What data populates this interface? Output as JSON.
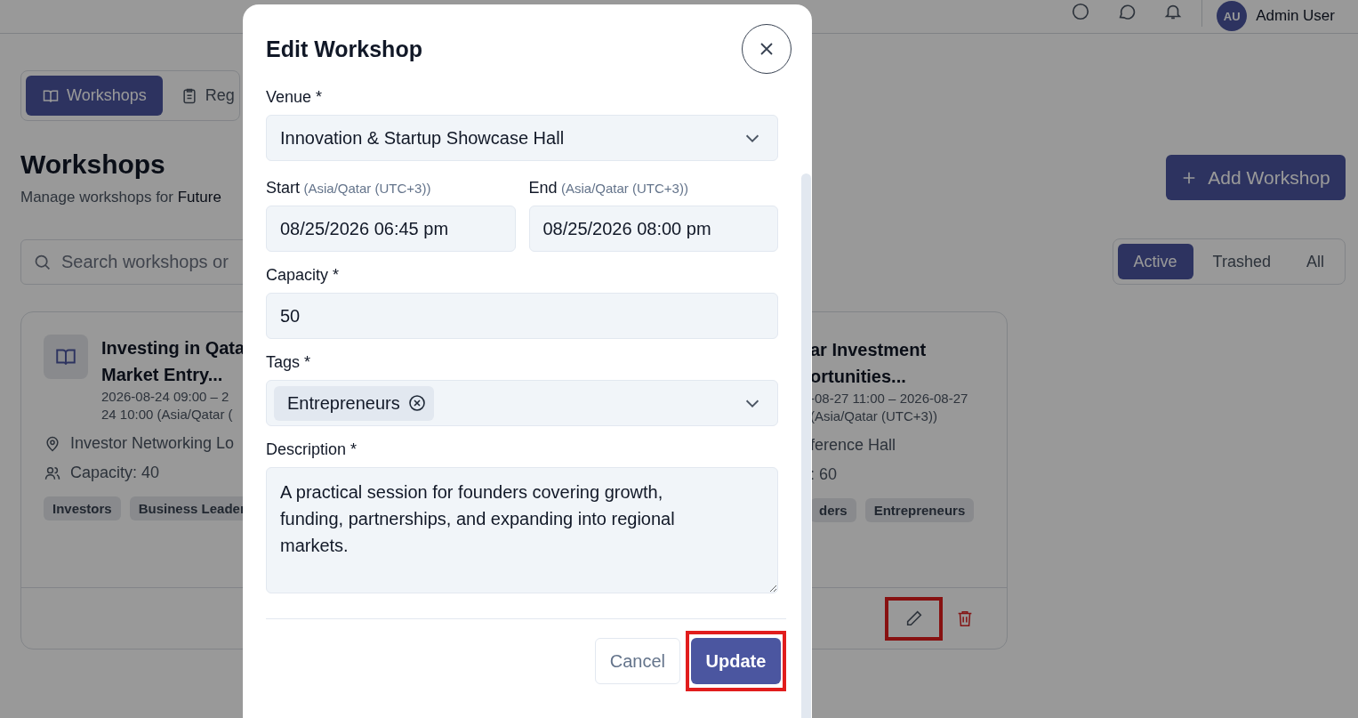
{
  "topbar": {
    "avatar_initials": "AU",
    "user_name": "Admin User"
  },
  "nav_tabs": [
    {
      "label": "Workshops",
      "selected": true
    },
    {
      "label": "Reg",
      "selected": false
    }
  ],
  "page": {
    "title": "Workshops",
    "subtitle": "Manage workshops for **Future**",
    "add_button": "Add Workshop"
  },
  "search": {
    "placeholder": "Search workshops or"
  },
  "filters": [
    {
      "label": "Active",
      "selected": true
    },
    {
      "label": "Trashed",
      "selected": false
    },
    {
      "label": "All",
      "selected": false
    }
  ],
  "cards": [
    {
      "title": [
        "Investing in Qata",
        "Market Entry..."
      ],
      "time": [
        "2026-08-24 09:00 – 2",
        "24 10:00 (Asia/Qatar ("
      ],
      "venue": "Investor Networking Lo",
      "capacity": "Capacity: 40",
      "tags": [
        "Investors",
        "Business Leader"
      ]
    },
    {
      "title": [
        "ar Investment",
        "ortunities..."
      ],
      "time": [
        "-08-27 11:00 – 2026-08-27",
        "(Asia/Qatar (UTC+3))"
      ],
      "venue": "ference Hall",
      "capacity": ": 60",
      "tags": [
        "ders",
        "Entrepreneurs"
      ],
      "actions": [
        {
          "kind": "edit",
          "highlighted": true
        },
        {
          "kind": "delete",
          "highlighted": false
        }
      ]
    }
  ],
  "modal": {
    "title": "Edit Workshop",
    "venue": {
      "label": "Venue *",
      "value": "Innovation & Startup Showcase Hall"
    },
    "start": {
      "label": "Start",
      "hint": "(Asia/Qatar (UTC+3))",
      "value": "08/25/2026 06:45 pm"
    },
    "end": {
      "label": "End",
      "hint": "(Asia/Qatar (UTC+3))",
      "value": "08/25/2026 08:00 pm"
    },
    "capacity": {
      "label": "Capacity *",
      "value": "50"
    },
    "tags": {
      "label": "Tags *",
      "chips": [
        "Entrepreneurs"
      ]
    },
    "description": {
      "label": "Description *",
      "value": "A practical session for founders covering growth, funding, partnerships, and expanding into regional markets."
    },
    "buttons": [
      {
        "label": "Cancel",
        "kind": "secondary",
        "highlighted": false
      },
      {
        "label": "Update",
        "kind": "primary",
        "highlighted": true
      }
    ]
  }
}
